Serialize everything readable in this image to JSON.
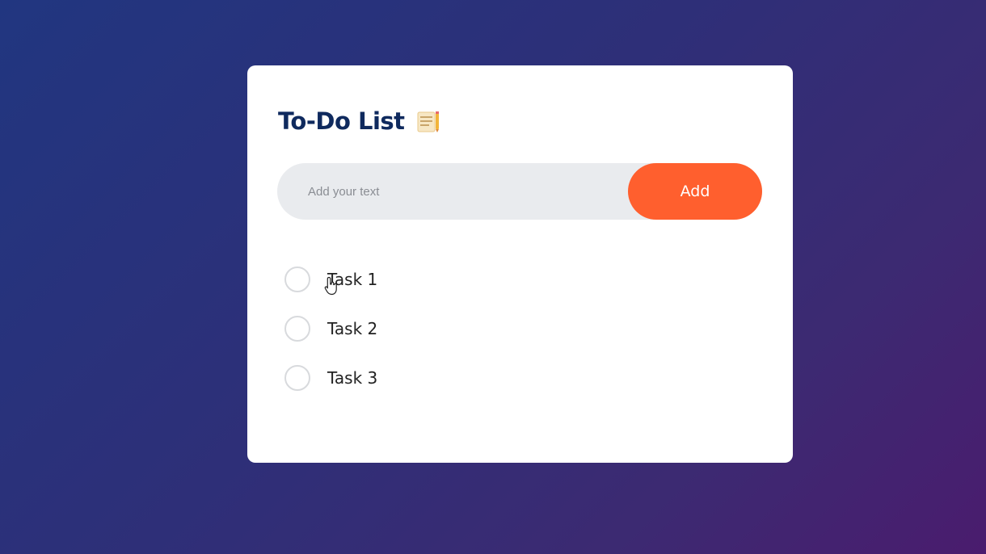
{
  "app": {
    "title": "To-Do List",
    "title_icon": "notepad-icon"
  },
  "input": {
    "placeholder": "Add your text",
    "value": ""
  },
  "add_button": {
    "label": "Add"
  },
  "tasks": [
    {
      "label": "Task 1",
      "checked": false
    },
    {
      "label": "Task 2",
      "checked": false
    },
    {
      "label": "Task 3",
      "checked": false
    }
  ],
  "colors": {
    "accent": "#ff5f2e",
    "title": "#0f2a5e",
    "input_bg": "#e9ebee",
    "bg_start": "#213680",
    "bg_end": "#4a1c6e"
  }
}
